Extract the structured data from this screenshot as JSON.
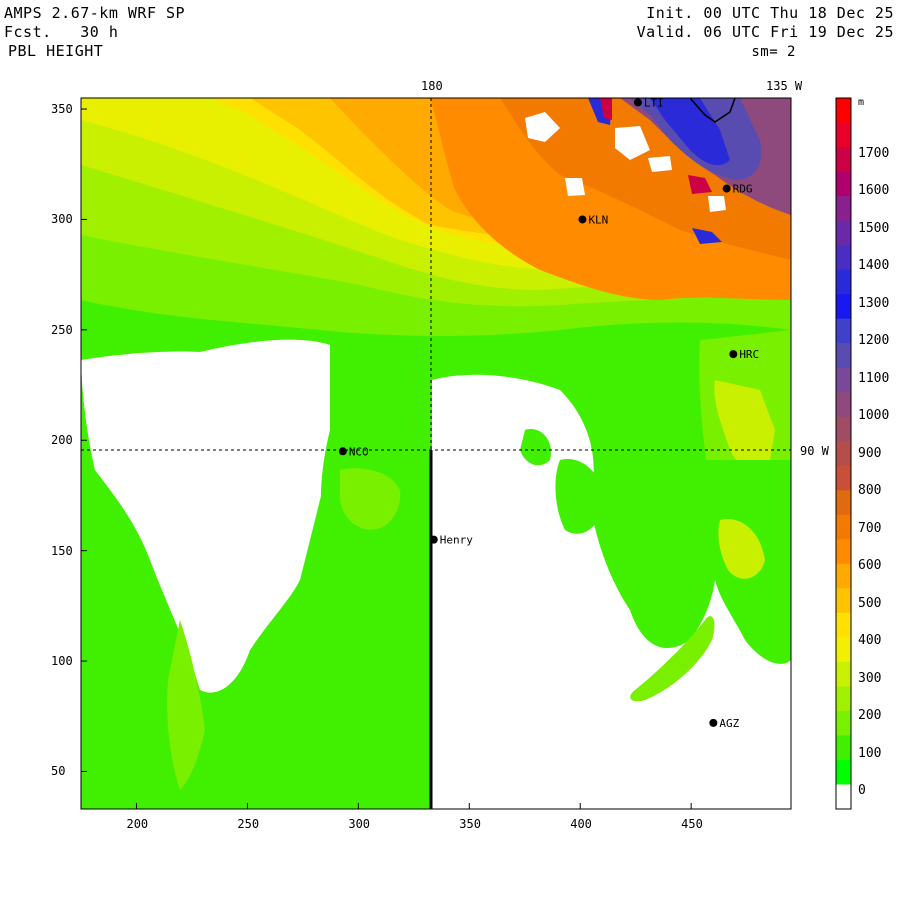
{
  "header": {
    "model": "AMPS 2.67-km WRF SP",
    "forecast": "Fcst.   30 h",
    "field": "PBL HEIGHT",
    "init": "Init. 00 UTC Thu 18 Dec 25",
    "valid": "Valid. 06 UTC Fri 19 Dec 25",
    "smoothing": "sm= 2"
  },
  "map": {
    "x_axis_ticks": [
      "200",
      "250",
      "300",
      "350",
      "400",
      "450"
    ],
    "y_axis_ticks": [
      "350",
      "300",
      "250",
      "200",
      "150",
      "100",
      "50"
    ],
    "x_range": [
      175,
      495
    ],
    "y_range": [
      33,
      355
    ],
    "meridian_labels": [
      "180",
      "135 W"
    ],
    "parallel_label": "90 W",
    "stations": [
      {
        "name": "NCO",
        "x": 293,
        "y": 195
      },
      {
        "name": "Henry",
        "x": 334,
        "y": 155
      },
      {
        "name": "KLN",
        "x": 401,
        "y": 300
      },
      {
        "name": "RDG",
        "x": 466,
        "y": 314
      },
      {
        "name": "HRC",
        "x": 469,
        "y": 239
      },
      {
        "name": "AGZ",
        "x": 460,
        "y": 72
      },
      {
        "name": "LTI",
        "x": 426,
        "y": 353
      }
    ]
  },
  "colorbar": {
    "unit": "m",
    "labels": [
      "1700",
      "1600",
      "1500",
      "1400",
      "1300",
      "1200",
      "1100",
      "1000",
      "900",
      "800",
      "700",
      "600",
      "500",
      "400",
      "300",
      "200",
      "100",
      "0"
    ],
    "colors": [
      "#ff0000",
      "#e8002a",
      "#cc0044",
      "#b0006e",
      "#88208e",
      "#6a2aa8",
      "#4a2ec4",
      "#2a2ad8",
      "#1818f0",
      "#4040c8",
      "#584cb0",
      "#7a4898",
      "#8e4a7c",
      "#a04c62",
      "#b44e4a",
      "#c85038",
      "#e06a10",
      "#f27a00",
      "#ff8c00",
      "#ffaa00",
      "#ffc400",
      "#ffe000",
      "#f0f000",
      "#c8f000",
      "#a0f000",
      "#78f000",
      "#40f000",
      "#00ff00",
      "#ffffff"
    ]
  }
}
